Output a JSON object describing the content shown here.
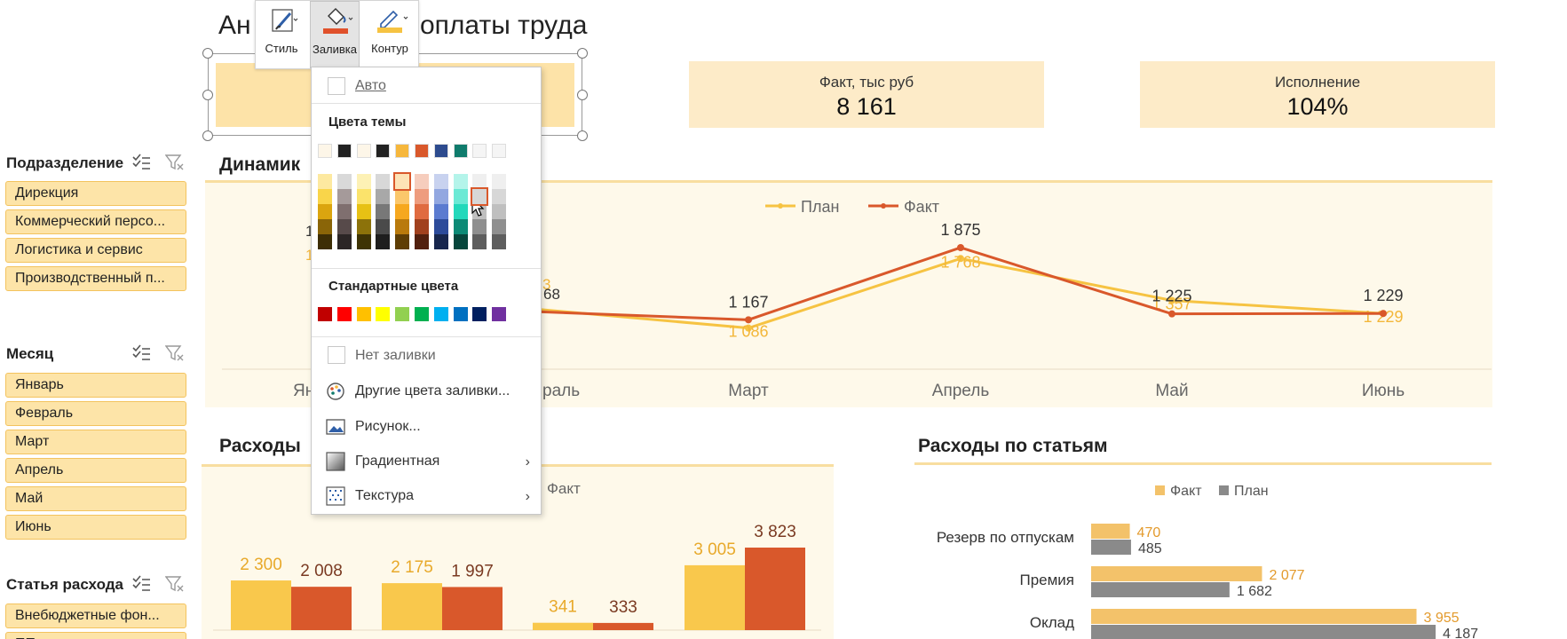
{
  "dashboard": {
    "title_visible_left": "Ан",
    "title_visible_right": "оплаты труда",
    "kpis": [
      {
        "label": "Факт, тыс руб",
        "value": "8 161"
      },
      {
        "label": "Исполнение",
        "value": "104%"
      }
    ]
  },
  "slicers": {
    "division": {
      "title": "Подразделение",
      "items": [
        "Дирекция",
        "Коммерческий персо...",
        "Логистика и сервис",
        "Производственный п..."
      ]
    },
    "month": {
      "title": "Месяц",
      "items": [
        "Январь",
        "Февраль",
        "Март",
        "Апрель",
        "Май",
        "Июнь"
      ]
    },
    "expense": {
      "title": "Статья расхода",
      "items": [
        "Внебюджетные фон...",
        "ПП..."
      ]
    }
  },
  "mini_toolbar": {
    "buttons": [
      {
        "label": "Стиль",
        "icon": "brush-icon"
      },
      {
        "label": "Заливка",
        "icon": "paint-bucket-icon"
      },
      {
        "label": "Контур",
        "icon": "pen-outline-icon"
      }
    ],
    "fill_color": "#e0512b",
    "outline_color": "#f6c342"
  },
  "fill_menu": {
    "auto": "Авто",
    "theme_colors_title": "Цвета темы",
    "standard_colors_title": "Стандартные цвета",
    "no_fill": "Нет заливки",
    "more_colors": "Другие цвета заливки...",
    "picture": "Рисунок...",
    "gradient": "Градиентная",
    "texture": "Текстура",
    "theme_top_row": [
      "#fdf6e8",
      "#222222",
      "#fdf6e8",
      "#222222",
      "#f6b73c",
      "#d9582b",
      "#2d4b8e",
      "#0f7b6c",
      "#f5f5f5",
      "#f5f5f5"
    ],
    "theme_columns": [
      [
        "#fde9a0",
        "#f9d54a",
        "#dba50f",
        "#8a6508",
        "#3d2e05"
      ],
      [
        "#d9d9d9",
        "#a59a9a",
        "#7f6f6f",
        "#574a4a",
        "#2b2525"
      ],
      [
        "#fdf1b5",
        "#fbe36b",
        "#e7c114",
        "#8c720a",
        "#3e3304"
      ],
      [
        "#d8d8d8",
        "#a8a8a8",
        "#787878",
        "#4a4a4a",
        "#1e1e1e"
      ],
      [
        "#fde3b6",
        "#fbc76b",
        "#f6a81f",
        "#b97a0c",
        "#5e3e05"
      ],
      [
        "#f6cdbd",
        "#ee9c7e",
        "#e06b40",
        "#a1411e",
        "#52200e"
      ],
      [
        "#c8d2ef",
        "#92a7e0",
        "#5b7bd0",
        "#2c4b9a",
        "#17264d"
      ],
      [
        "#b4f4ea",
        "#6be9d5",
        "#23d8bb",
        "#0c8a76",
        "#06463c"
      ],
      [
        "#efefef",
        "#d7d7d7",
        "#bfbfbf",
        "#8f8f8f",
        "#5e5e5e"
      ],
      [
        "#efefef",
        "#d7d7d7",
        "#bfbfbf",
        "#8f8f8f",
        "#5e5e5e"
      ]
    ],
    "standard": [
      "#c00000",
      "#ff0000",
      "#ffc000",
      "#ffff00",
      "#92d050",
      "#00b050",
      "#00b0f0",
      "#0070c0",
      "#002060",
      "#7030a0"
    ]
  },
  "line_chart": {
    "section_title": "Динамик",
    "legend": [
      "План",
      "Факт"
    ],
    "colors": {
      "plan": "#f6c342",
      "fact": "#d9582b"
    },
    "chart_data": {
      "type": "line",
      "categories": [
        "Январь",
        "Февраль",
        "Март",
        "Апрель",
        "Май",
        "Июнь"
      ],
      "visible_x_labels": [
        "Ян",
        "раль",
        "Март",
        "Апрель",
        "Май",
        "Июнь"
      ],
      "series": [
        {
          "name": "План",
          "values": [
            null,
            null,
            1086,
            1768,
            1357,
            1229
          ]
        },
        {
          "name": "Факт",
          "values": [
            null,
            null,
            1167,
            1875,
            1225,
            1229
          ]
        }
      ],
      "visible_left_labels": [
        "1",
        "1",
        "3",
        "68"
      ]
    }
  },
  "bar_chart": {
    "section_title": "Расходы",
    "legend_fact": "Факт",
    "colors": {
      "plan": "#f9c84c",
      "fact": "#d9582b"
    },
    "chart_data": {
      "type": "bar",
      "groups": 4,
      "series": [
        {
          "name": "План",
          "values": [
            2300,
            2175,
            341,
            3005
          ]
        },
        {
          "name": "Факт",
          "values": [
            2008,
            1997,
            333,
            3823
          ]
        }
      ],
      "value_labels_plan": [
        "2 300",
        "2 175",
        "341",
        "3 005"
      ],
      "value_labels_fact": [
        "2 008",
        "1 997",
        "333",
        "3 823"
      ]
    }
  },
  "hbar_chart": {
    "section_title": "Расходы по статьям",
    "legend": [
      "Факт",
      "План"
    ],
    "colors": {
      "fact": "#f3c26a",
      "plan": "#8a8a8a"
    },
    "chart_data": {
      "type": "bar",
      "categories": [
        "Резерв по отпускам",
        "Премия",
        "Оклад"
      ],
      "series": [
        {
          "name": "Факт",
          "values": [
            470,
            2077,
            3955
          ]
        },
        {
          "name": "План",
          "values": [
            485,
            1682,
            4187
          ]
        }
      ],
      "value_labels_fact": [
        "470",
        "2 077",
        "3 955"
      ],
      "value_labels_plan": [
        "485",
        "1 682",
        "4 187"
      ]
    }
  }
}
